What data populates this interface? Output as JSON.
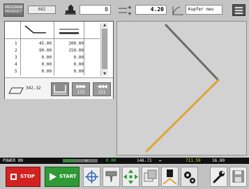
{
  "header": {
    "program_label_line1": "PROGRAM",
    "program_label_line2": "PRODUCT",
    "program_number": "682",
    "count_value": "0",
    "thickness_value": "4.20",
    "material_value": "Kupfer neu"
  },
  "table": {
    "rows": [
      {
        "n": "1",
        "a": "45.00",
        "b": "200.00"
      },
      {
        "n": "2",
        "a": "90.00",
        "b": "150.00"
      },
      {
        "n": "3",
        "a": "0.00",
        "b": "0.00"
      },
      {
        "n": "4",
        "a": "0.00",
        "b": "0.00"
      },
      {
        "n": "5",
        "a": "0.00",
        "b": "0.00"
      }
    ],
    "total_length": "342.32",
    "step_forward_label": "123",
    "step_back_label": "321"
  },
  "status": {
    "power": "POWER ON",
    "pos1": "0.00",
    "pos2": "146.71",
    "pos3": "711.59",
    "pos4": "16.80",
    "progress": 0.35
  },
  "toolbar": {
    "stop_label": "STOP",
    "start_label": "START"
  },
  "colors": {
    "stop": "#d32222",
    "start": "#2f9a36",
    "bend_line_grey": "#6b6b6b",
    "bend_line_orange": "#e0a535"
  },
  "icons": [
    "machine-icon",
    "thickness-icon",
    "bend-angle-icon",
    "menu-icon",
    "profile-icon",
    "length-icon",
    "crosshair-icon",
    "tool-icon",
    "move-icon",
    "copy-icon",
    "bend-icon",
    "settings-icon",
    "wrench-icon",
    "save-icon"
  ]
}
